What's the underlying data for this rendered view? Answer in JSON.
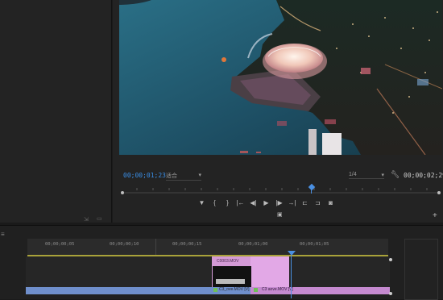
{
  "program": {
    "current_timecode": "00;00;01;23",
    "fit_label": "适合",
    "quality_label": "1/4",
    "duration_timecode": "00;00;02;29"
  },
  "timeline": {
    "ruler_labels": [
      "00;00;00;05",
      "00;00;00;10",
      "00;00;00;15",
      "00;00;01;00",
      "00;00;01;05"
    ],
    "clip_video_label": "C0003.MOV",
    "clip_audio_label": "C3_ove.MOV [V]",
    "clip_audio_label2": "C3 aove.MOV [V]"
  },
  "colors": {
    "timecode_blue": "#3a8ee6",
    "playhead_blue": "#4a90e2",
    "clip_pink": "#d49ad6",
    "audio_blue": "#6f8fcc"
  },
  "icons": {
    "transport": [
      "marker",
      "in-point",
      "out-point",
      "go-to-in",
      "step-back",
      "play",
      "step-forward",
      "go-to-out",
      "insert",
      "overwrite",
      "export-frame"
    ]
  }
}
